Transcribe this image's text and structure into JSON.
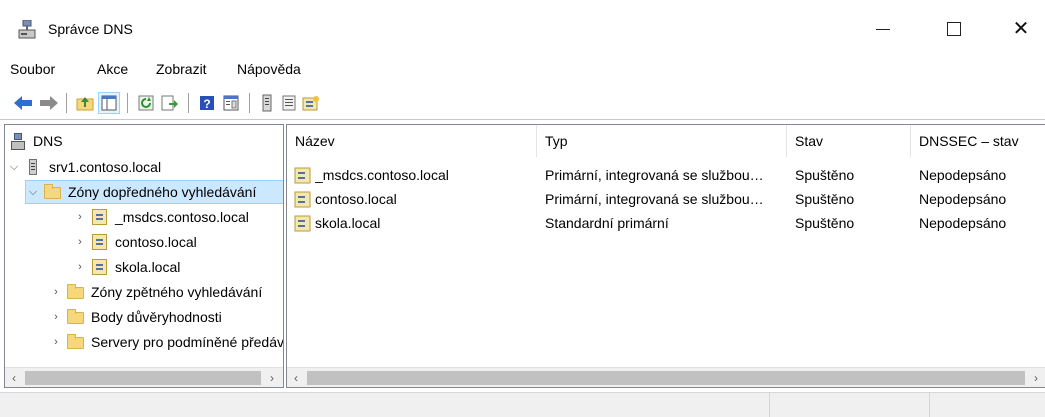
{
  "window": {
    "title": "Správce DNS",
    "icon": "dns-manager-icon"
  },
  "menu": [
    "Soubor",
    "Akce",
    "Zobrazit",
    "Nápověda"
  ],
  "toolbar": {
    "buttons": [
      "back-arrow-icon",
      "forward-arrow-icon",
      "up-folder-icon",
      "show-hide-tree-icon",
      "refresh-icon",
      "export-list-icon",
      "help-icon",
      "properties-icon",
      "server-icon",
      "zone-list-icon",
      "new-zone-icon"
    ]
  },
  "tree": {
    "root": "DNS",
    "server": "srv1.contoso.local",
    "forward_zones": "Zóny dopředného vyhledávání",
    "zones": [
      "_msdcs.contoso.local",
      "contoso.local",
      "skola.local"
    ],
    "reverse_zones": "Zóny zpětného vyhledávání",
    "trust_points": "Body důvěryhodnosti",
    "conditional_forwarders": "Servery pro podmíněné předávání"
  },
  "list": {
    "columns": [
      "Název",
      "Typ",
      "Stav",
      "DNSSEC – stav"
    ],
    "rows": [
      {
        "name": "_msdcs.contoso.local",
        "type": "Primární, integrovaná se službou…",
        "status": "Spuštěno",
        "dnssec": "Nepodepsáno"
      },
      {
        "name": "contoso.local",
        "type": "Primární, integrovaná se službou…",
        "status": "Spuštěno",
        "dnssec": "Nepodepsáno"
      },
      {
        "name": "skola.local",
        "type": "Standardní primární",
        "status": "Spuštěno",
        "dnssec": "Nepodepsáno"
      }
    ]
  },
  "colors": {
    "selection": "#cce8ff",
    "folder": "#f6d77c",
    "nav_arrow": "#2d6fd1"
  }
}
